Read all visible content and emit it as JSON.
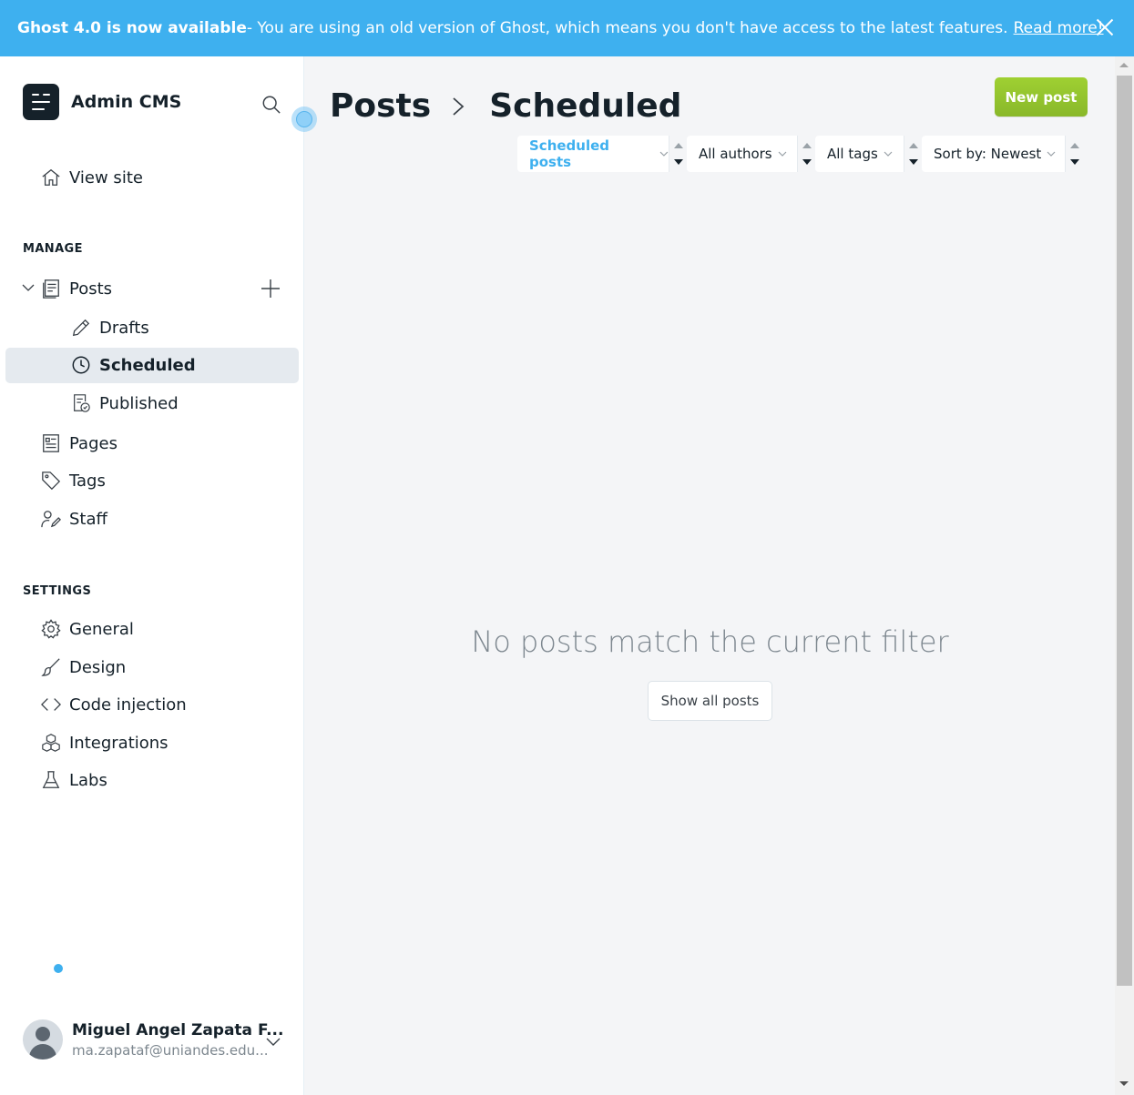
{
  "banner": {
    "title": "Ghost 4.0 is now available",
    "message": " - You are using an old version of Ghost, which means you don't have access to the latest features.",
    "link": "Read more!"
  },
  "brand": {
    "title": "Admin CMS"
  },
  "nav": {
    "view_site": "View site",
    "manage_label": "MANAGE",
    "posts": "Posts",
    "drafts": "Drafts",
    "scheduled": "Scheduled",
    "published": "Published",
    "pages": "Pages",
    "tags": "Tags",
    "staff": "Staff",
    "settings_label": "SETTINGS",
    "general": "General",
    "design": "Design",
    "code_injection": "Code injection",
    "integrations": "Integrations",
    "labs": "Labs"
  },
  "user": {
    "name": "Miguel Angel Zapata F...",
    "email": "ma.zapataf@uniandes.edu..."
  },
  "header": {
    "crumb_parent": "Posts",
    "crumb_current": "Scheduled",
    "new_post": "New post"
  },
  "filters": {
    "type": "Scheduled posts",
    "author": "All authors",
    "tag": "All tags",
    "sort": "Sort by: Newest"
  },
  "empty": {
    "message": "No posts match the current filter",
    "show_all": "Show all posts"
  },
  "colors": {
    "accent": "#3eb0ef",
    "new_post_button": "#9fd032",
    "active_nav": "#e5eaef"
  }
}
